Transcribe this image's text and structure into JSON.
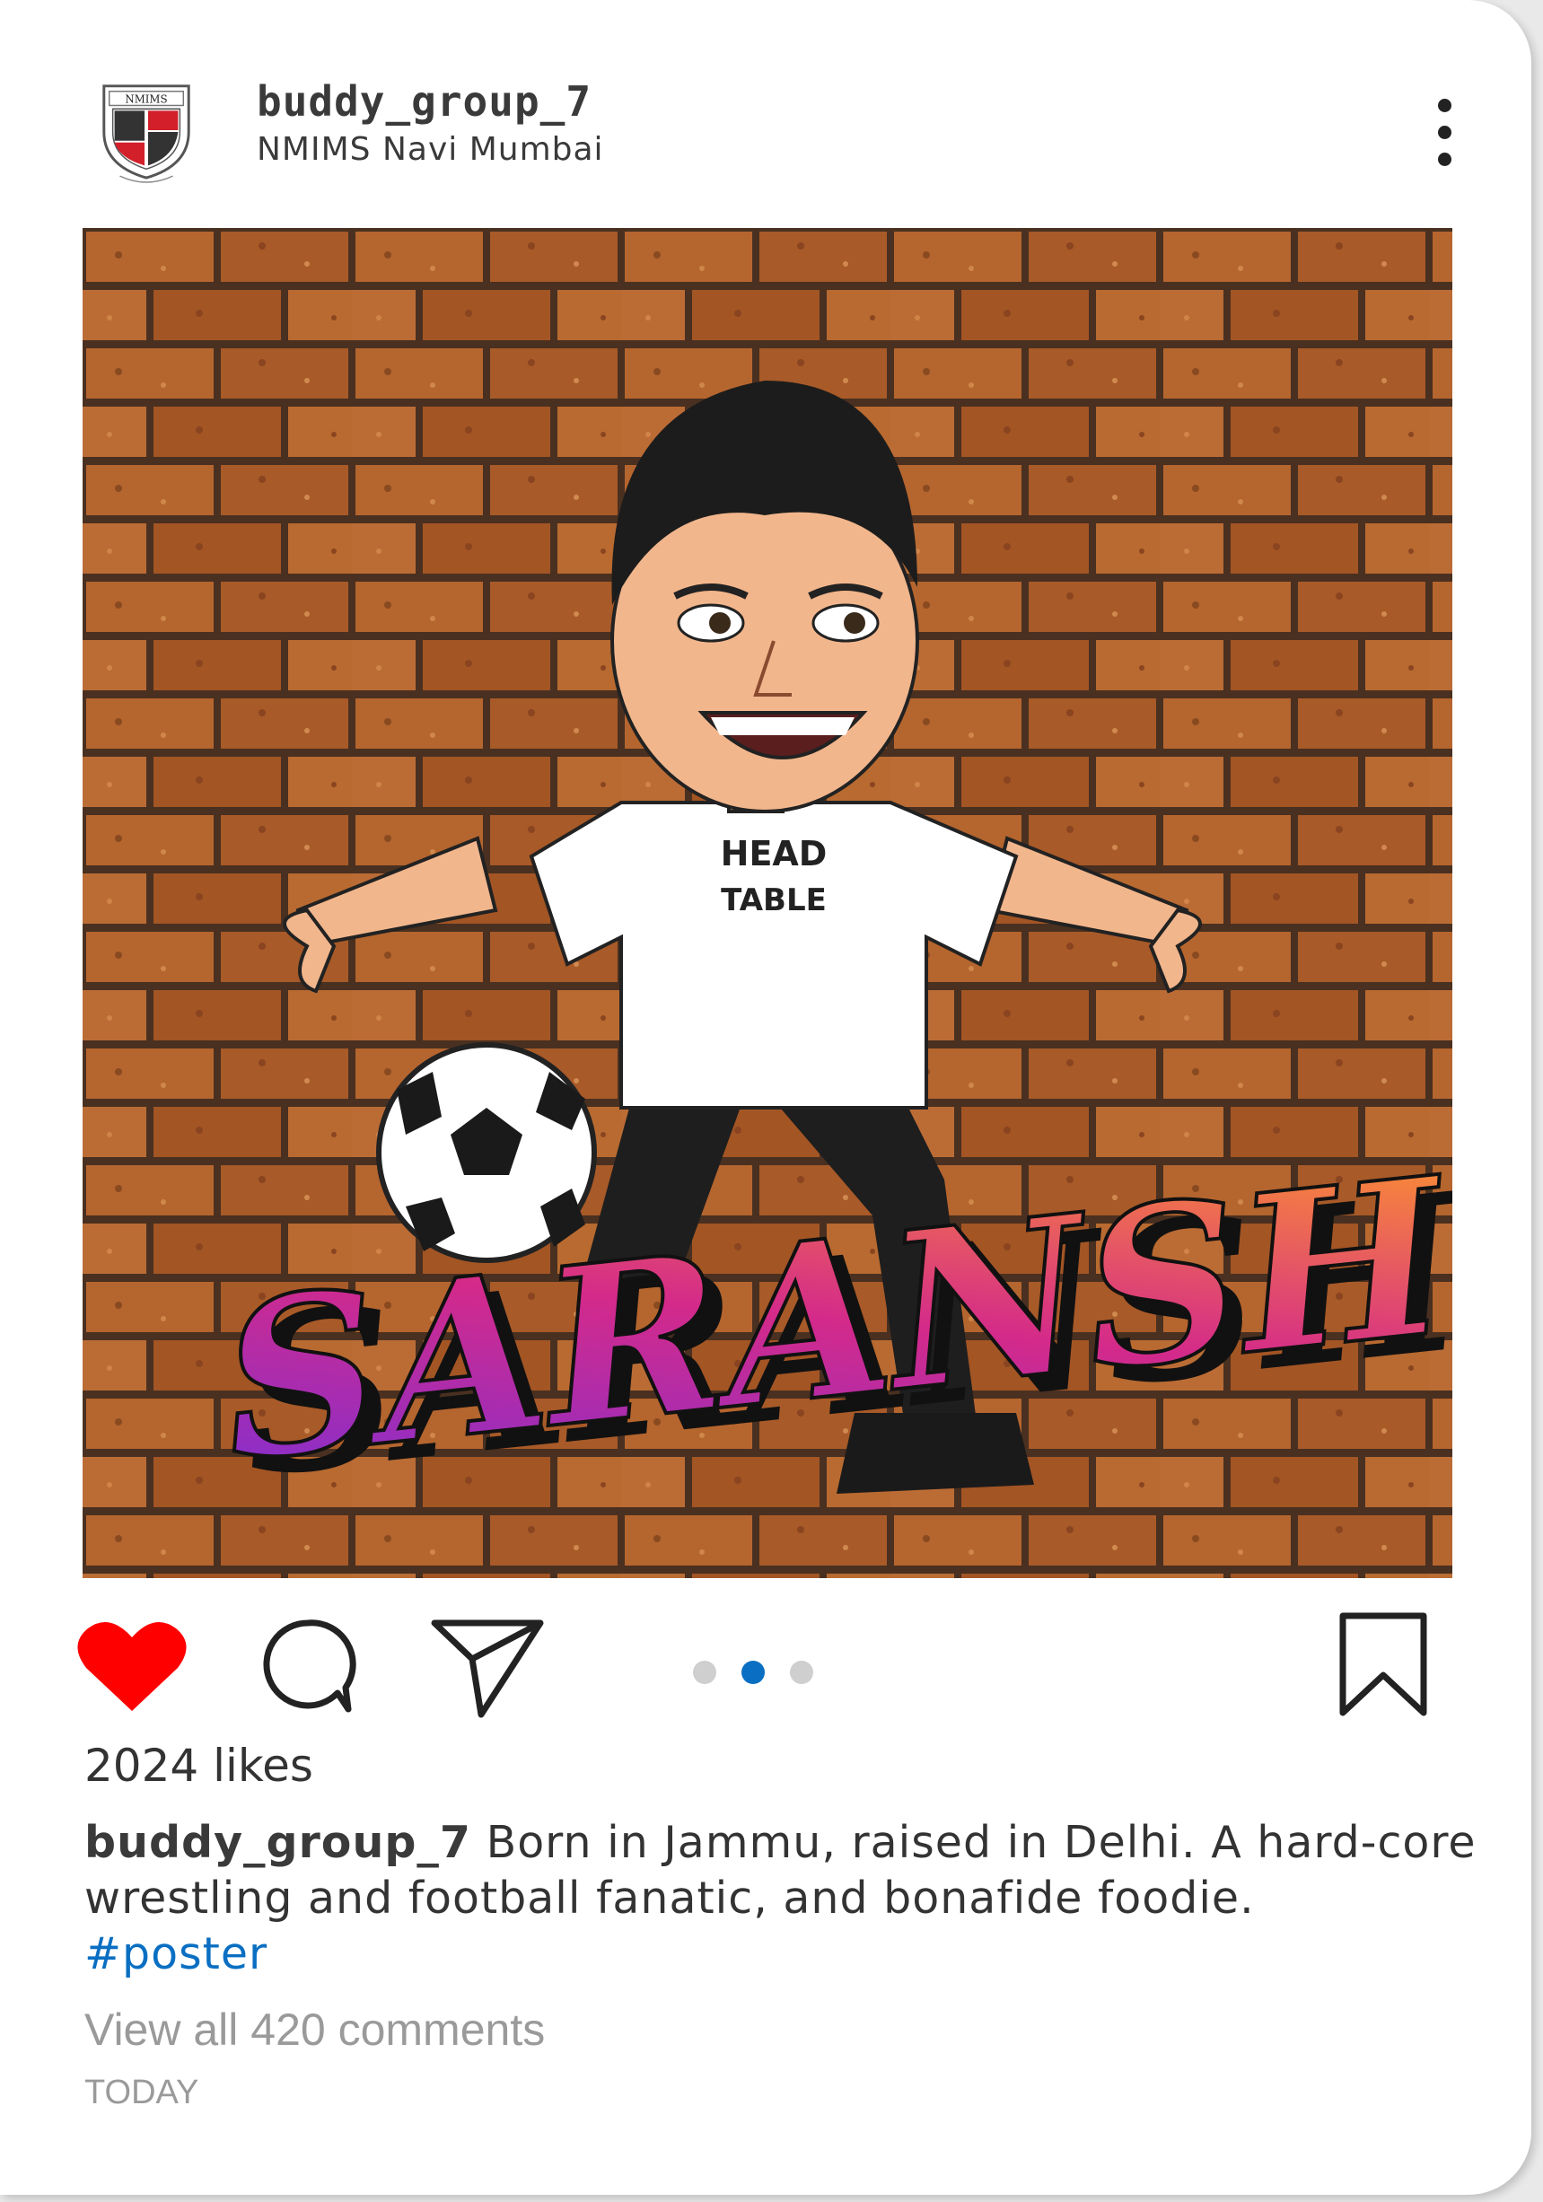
{
  "post": {
    "username": "buddy_group_7",
    "location": "NMIMS Navi Mumbai",
    "avatar_logo_text": "NMIMS",
    "image": {
      "banner_text": "SARANSH",
      "shirt_text_top": "HEAD",
      "shirt_text_bottom": "TABLE"
    },
    "likes_label": "2024 likes",
    "caption": {
      "user": "buddy_group_7",
      "text": " Born in Jammu, raised in Delhi. A hard-core wrestling and football fanatic, and bonafide foodie.",
      "hashtag": "#poster"
    },
    "comments_label": "View all 420 comments",
    "date_label": "TODAY",
    "carousel": {
      "count": 3,
      "active_index": 1
    },
    "liked": true
  },
  "colors": {
    "like": "#ff0000",
    "link": "#0a6fc2",
    "muted": "#9a9a9a",
    "brick": "#b0622c"
  },
  "icons": {
    "like": "heart-icon",
    "comment": "comment-bubble-icon",
    "share": "paper-plane-icon",
    "save": "bookmark-icon",
    "menu": "more-vertical-icon"
  }
}
